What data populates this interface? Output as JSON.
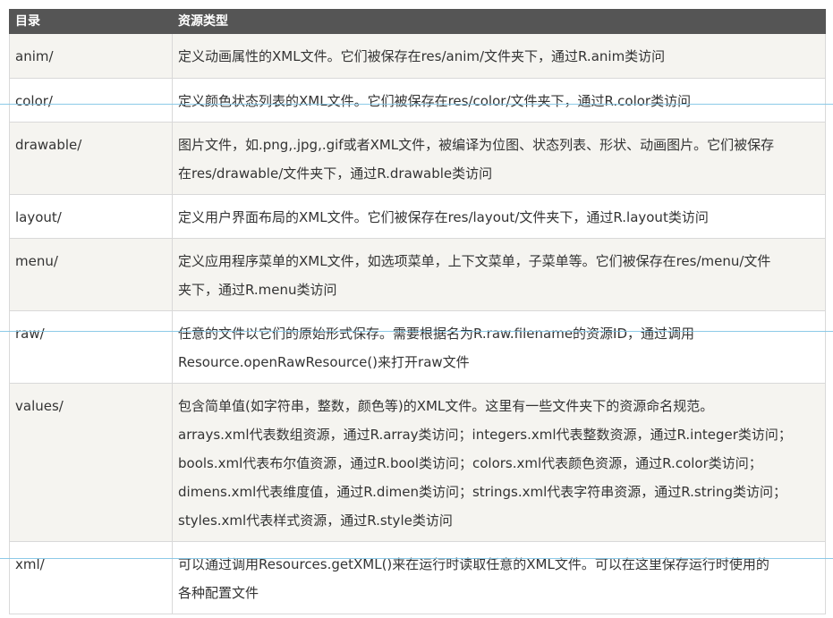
{
  "table": {
    "headers": [
      "目录",
      "资源类型"
    ],
    "rows": [
      {
        "dir": "anim/",
        "lines": [
          "定义动画属性的XML文件。它们被保存在res/anim/文件夹下，通过R.anim类访问"
        ]
      },
      {
        "dir": "color/",
        "lines": [
          "定义颜色状态列表的XML文件。它们被保存在res/color/文件夹下，通过R.color类访问"
        ]
      },
      {
        "dir": "drawable/",
        "lines": [
          "图片文件，如.png,.jpg,.gif或者XML文件，被编译为位图、状态列表、形状、动画图片。它们被保存",
          "在res/drawable/文件夹下，通过R.drawable类访问"
        ]
      },
      {
        "dir": "layout/",
        "lines": [
          "定义用户界面布局的XML文件。它们被保存在res/layout/文件夹下，通过R.layout类访问"
        ]
      },
      {
        "dir": "menu/",
        "lines": [
          "定义应用程序菜单的XML文件，如选项菜单，上下文菜单，子菜单等。它们被保存在res/menu/文件",
          "夹下，通过R.menu类访问"
        ]
      },
      {
        "dir": "raw/",
        "lines": [
          "任意的文件以它们的原始形式保存。需要根据名为R.raw.filename的资源ID，通过调用",
          "Resource.openRawResource()来打开raw文件"
        ]
      },
      {
        "dir": "values/",
        "lines": [
          "包含简单值(如字符串，整数，颜色等)的XML文件。这里有一些文件夹下的资源命名规范。",
          "arrays.xml代表数组资源，通过R.array类访问；integers.xml代表整数资源，通过R.integer类访问；",
          "bools.xml代表布尔值资源，通过R.bool类访问；colors.xml代表颜色资源，通过R.color类访问；",
          "dimens.xml代表维度值，通过R.dimen类访问；strings.xml代表字符串资源，通过R.string类访问；",
          "styles.xml代表样式资源，通过R.style类访问"
        ]
      },
      {
        "dir": "xml/",
        "lines": [
          "可以通过调用Resources.getXML()来在运行时读取任意的XML文件。可以在这里保存运行时使用的",
          "各种配置文件"
        ]
      }
    ]
  },
  "colors": {
    "header_bg": "#555555",
    "row_odd_bg": "#f5f4f0",
    "row_even_bg": "#ffffff",
    "border": "#d9d9d9",
    "guide_line": "#7fc4e6"
  }
}
